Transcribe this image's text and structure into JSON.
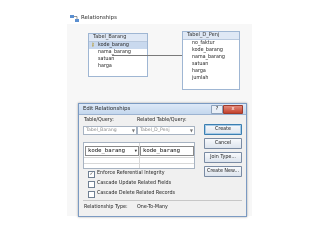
{
  "window": {
    "title": "Relationships",
    "icon": "relationships-icon"
  },
  "tables": [
    {
      "name": "Tabel_Barang",
      "fields": [
        {
          "name": "kode_barang",
          "key": true
        },
        {
          "name": "nama_barang",
          "key": false
        },
        {
          "name": "satuan",
          "key": false
        },
        {
          "name": "harga",
          "key": false
        }
      ]
    },
    {
      "name": "Tabel_D_Penj",
      "fields": [
        {
          "name": "no_faktur"
        },
        {
          "name": "kode_barang"
        },
        {
          "name": "nama_barang"
        },
        {
          "name": "satuan"
        },
        {
          "name": "harga"
        },
        {
          "name": "jumlah"
        }
      ]
    }
  ],
  "dialog": {
    "title": "Edit Relationships",
    "help_label": "?",
    "close_label": "x",
    "table_query_label": "Table/Query:",
    "related_table_query_label": "Related Table/Query:",
    "table_value": "Tabel_Barang",
    "related_table_value": "Tabel_D_Penj",
    "field_left": "kode_barang",
    "field_right": "kode_barang",
    "buttons": {
      "create": "Create",
      "cancel": "Cancel",
      "join_type": "Join Type...",
      "create_new": "Create New..."
    },
    "checkboxes": [
      {
        "label": "Enforce Referential Integrity",
        "checked": true
      },
      {
        "label": "Cascade Update Related Fields",
        "checked": false
      },
      {
        "label": "Cascade Delete Related Records",
        "checked": false
      }
    ],
    "relationship_type_label": "Relationship Type:",
    "relationship_type_value": "One-To-Many"
  }
}
